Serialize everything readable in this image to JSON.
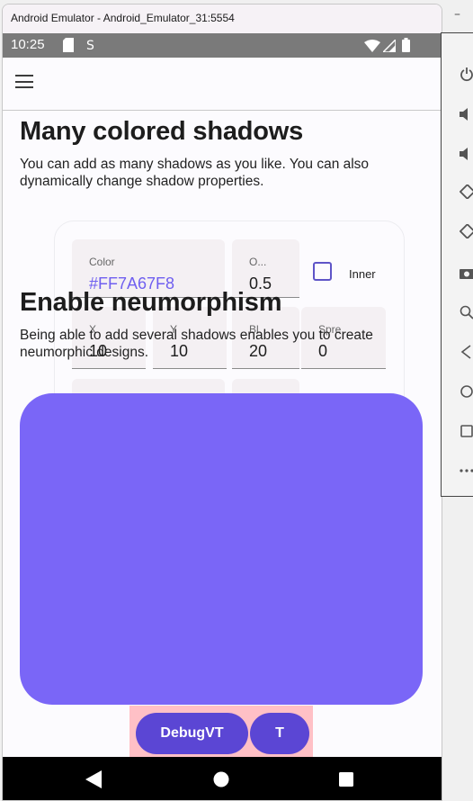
{
  "window": {
    "title": "Android Emulator - Android_Emulator_31:5554"
  },
  "status_bar": {
    "time": "10:25"
  },
  "section1": {
    "title": "Many colored shadows",
    "description": "You can add as many shadows as you like. You can also dynamically change shadow properties."
  },
  "section2": {
    "title": "Enable neumorphism",
    "description": "Being able to add several shadows enables you to create neumorphic designs."
  },
  "shadow_editor": {
    "color_label": "Color",
    "color_value": "#FF7A67F8",
    "opacity_label": "O...",
    "opacity_value": "0.5",
    "inner_label": "Inner",
    "inner_checked": false,
    "x_label": "X",
    "x_value": "10",
    "y_label": "Y",
    "y_value": "10",
    "blur_label": "Bl",
    "blur_value": "20",
    "spread_label": "Spre",
    "spread_value": "0"
  },
  "preview": {
    "color": "#7A66F7"
  },
  "debug_buttons": {
    "debugvt": "DebugVT",
    "t": "T"
  },
  "colors": {
    "accent": "#5B46D4",
    "status_bar": "#7A7A7A",
    "debug_bg": "#FFC0C6"
  }
}
